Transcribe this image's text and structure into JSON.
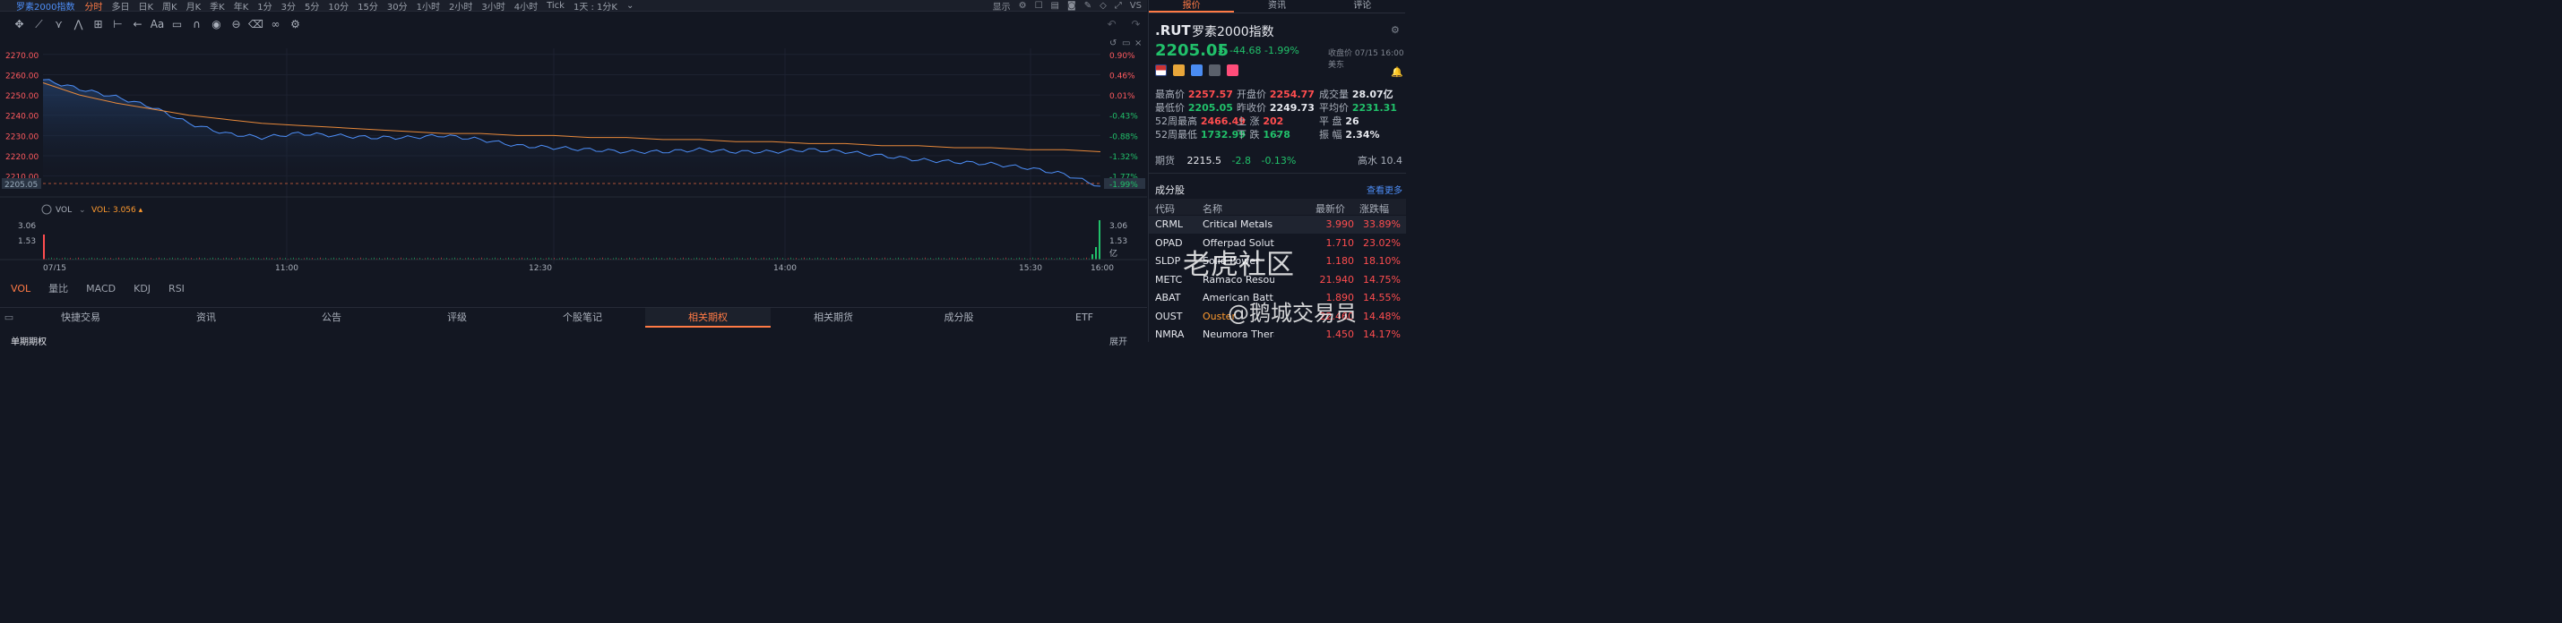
{
  "topbar": {
    "title": "罗素2000指数",
    "intervals": [
      "分时",
      "多日",
      "日K",
      "周K",
      "月K",
      "季K",
      "年K",
      "1分",
      "3分",
      "5分",
      "10分",
      "15分",
      "30分",
      "1小时",
      "2小时",
      "3小时",
      "4小时",
      "Tick"
    ],
    "active_interval": "分时",
    "range": "1天 : 1分K",
    "display_label": "显示",
    "vs_label": "VS"
  },
  "chart": {
    "price_ticks": [
      "2270.00",
      "2260.00",
      "2250.00",
      "2240.00",
      "2230.00",
      "2220.00",
      "2210.00"
    ],
    "pct_ticks": [
      "0.90%",
      "0.46%",
      "0.01%",
      "-0.43%",
      "-0.88%",
      "-1.32%",
      "-1.77%"
    ],
    "last_price_label": "2205.05",
    "last_pct_label": "-1.99%",
    "vol_label": "VOL",
    "vol_value": "VOL: 3.056",
    "vol_left_ticks": [
      "3.06",
      "1.53"
    ],
    "vol_right_ticks": [
      "3.06",
      "1.53",
      "亿"
    ],
    "time_labels": [
      "07/15",
      "11:00",
      "12:30",
      "14:00",
      "15:30",
      "16:00"
    ]
  },
  "chart_data": {
    "type": "line",
    "x_range": [
      "09:30",
      "16:00"
    ],
    "ylim": [
      2205,
      2273
    ],
    "series": [
      {
        "values": [
          2257.5,
          2253,
          2249,
          2244,
          2236,
          2231,
          2229,
          2231,
          2230,
          2229,
          2229,
          2230,
          2228,
          2225,
          2224,
          2223,
          2222,
          2222,
          2223,
          2222,
          2222,
          2223,
          2222,
          2220,
          2218,
          2217,
          2216,
          2214,
          2211,
          2205
        ]
      },
      {
        "values": [
          2256,
          2250,
          2246,
          2243,
          2240,
          2238,
          2236,
          2235,
          2234,
          2233,
          2232,
          2231,
          2231,
          2230,
          2230,
          2229,
          2229,
          2228,
          2228,
          2227,
          2227,
          2226,
          2226,
          2225,
          2225,
          2224,
          2224,
          2223,
          2223,
          2222
        ]
      }
    ]
  },
  "indicators": [
    "VOL",
    "量比",
    "MACD",
    "KDJ",
    "RSI"
  ],
  "bottom_tabs": [
    "快捷交易",
    "资讯",
    "公告",
    "评级",
    "个股笔记",
    "相关期权",
    "相关期货",
    "成分股",
    "ETF"
  ],
  "active_tab": "相关期权",
  "subbar": {
    "left": "单期期权",
    "right": "展开"
  },
  "quote": {
    "tabs": [
      "报价",
      "资讯",
      "评论"
    ],
    "symbol": ".RUT",
    "name": "罗素2000指数",
    "price": "2205.05",
    "change": "-44.68",
    "change_pct": "-1.99%",
    "quote_time": "收盘价 07/15 16:00 美东",
    "stats": [
      {
        "label": "最高价",
        "value": "2257.57"
      },
      {
        "label": "开盘价",
        "value": "2254.77"
      },
      {
        "label": "成交量",
        "value": "28.07亿"
      },
      {
        "label": "最低价",
        "value": "2205.05"
      },
      {
        "label": "昨收价",
        "value": "2249.73"
      },
      {
        "label": "平均价",
        "value": "2231.31"
      },
      {
        "label": "52周最高",
        "value": "2466.49"
      },
      {
        "label": "上 涨",
        "value": "202"
      },
      {
        "label": "平 盘",
        "value": "26"
      },
      {
        "label": "52周最低",
        "value": "1732.99"
      },
      {
        "label": "下 跌",
        "value": "1678"
      },
      {
        "label": "振 幅",
        "value": "2.34%"
      }
    ],
    "futures_label": "期货",
    "futures_price": "2215.5",
    "futures_change": "-2.8",
    "futures_pct": "-0.13%",
    "futures_right": "高水 10.4"
  },
  "components": {
    "title": "成分股",
    "more": "查看更多",
    "columns": [
      "代码",
      "名称",
      "最新价",
      "涨跌幅"
    ],
    "rows": [
      {
        "code": "CRML",
        "name": "Critical Metals",
        "price": "3.990",
        "pct": "33.89%"
      },
      {
        "code": "OPAD",
        "name": "Offerpad Solut",
        "price": "1.710",
        "pct": "23.02%"
      },
      {
        "code": "SLDP",
        "name": "Solid Power",
        "price": "1.180",
        "pct": "18.10%"
      },
      {
        "code": "METC",
        "name": "Ramaco Resou",
        "price": "21.940",
        "pct": "14.75%"
      },
      {
        "code": "ABAT",
        "name": "American Batt",
        "price": "1.890",
        "pct": "14.55%"
      },
      {
        "code": "OUST",
        "name": "Ouster",
        "price": "22.460",
        "pct": "14.48%"
      },
      {
        "code": "NMRA",
        "name": "Neumora Thera",
        "price": "1.450",
        "pct": "14.17%"
      }
    ]
  },
  "watermark": {
    "line1": "老虎社区",
    "line2": "@鹅城交易员"
  }
}
